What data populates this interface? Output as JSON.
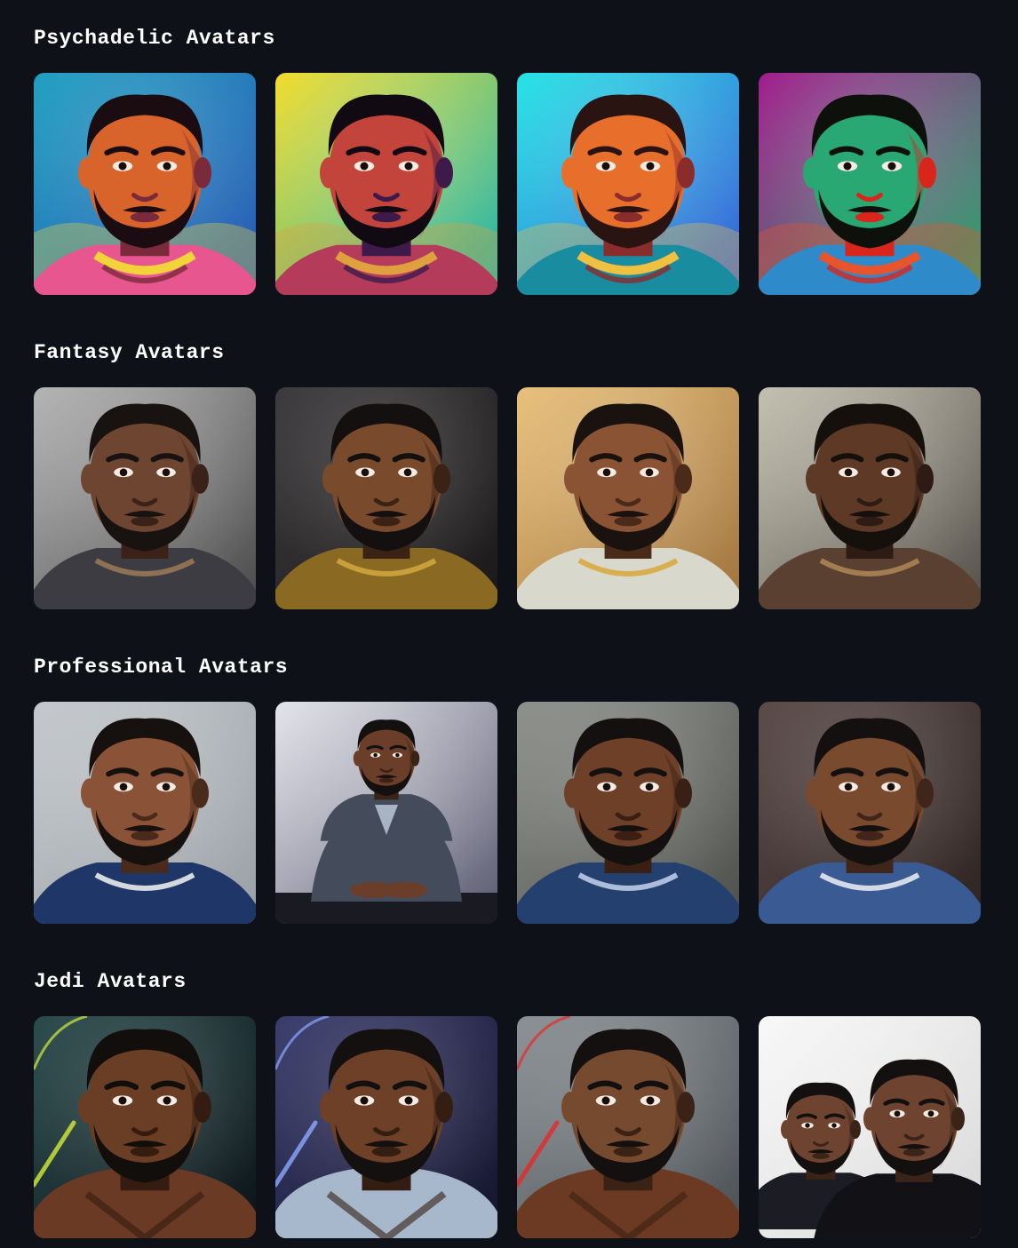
{
  "sections": [
    {
      "title": "Psychadelic Avatars",
      "avatars": [
        {
          "style": "psychedelic",
          "bg1": "#1f9fc0",
          "bg2": "#2a57b4",
          "skin": "#d8642c",
          "shade": "#7a2a3a",
          "hair": "#1a0c10",
          "beard": "#1a0c10",
          "outfit": "#e8568f",
          "accent": "#f2d43a"
        },
        {
          "style": "psychedelic",
          "bg1": "#f3dc2c",
          "bg2": "#18b4b4",
          "skin": "#c2443a",
          "shade": "#3d1a4a",
          "hair": "#120a12",
          "beard": "#120a12",
          "outfit": "#b43c5a",
          "accent": "#e0a040"
        },
        {
          "style": "psychedelic",
          "bg1": "#25e4e4",
          "bg2": "#3c5ad8",
          "skin": "#e86e2c",
          "shade": "#8a2c2c",
          "hair": "#2a1412",
          "beard": "#2a1412",
          "outfit": "#1a8ca0",
          "accent": "#f0c040"
        },
        {
          "style": "psychedelic",
          "bg1": "#a21c8c",
          "bg2": "#2ca86c",
          "skin": "#2aa874",
          "shade": "#d8261c",
          "hair": "#0e100c",
          "beard": "#0e100c",
          "outfit": "#2e8ac8",
          "accent": "#e8542c"
        }
      ]
    },
    {
      "title": "Fantasy Avatars",
      "avatars": [
        {
          "style": "realistic",
          "bg1": "#b4b4b4",
          "bg2": "#4a4a4a",
          "skin": "#6e4530",
          "shade": "#3a2218",
          "hair": "#181210",
          "beard": "#181210",
          "outfit": "#3c3c42",
          "accent": "#9c7a58"
        },
        {
          "style": "realistic",
          "bg1": "#3c3a3c",
          "bg2": "#1a1818",
          "skin": "#7a4a2c",
          "shade": "#3a2214",
          "hair": "#141010",
          "beard": "#141010",
          "outfit": "#8a6a22",
          "accent": "#d4a840"
        },
        {
          "style": "realistic",
          "bg1": "#e8c07a",
          "bg2": "#a0733e",
          "skin": "#8a5434",
          "shade": "#4a2a18",
          "hair": "#1a120e",
          "beard": "#1a120e",
          "outfit": "#d8d8cc",
          "accent": "#d8a838"
        },
        {
          "style": "realistic",
          "bg1": "#c4c0b0",
          "bg2": "#54504a",
          "skin": "#5e3a26",
          "shade": "#2e1c14",
          "hair": "#16100c",
          "beard": "#16100c",
          "outfit": "#5a4030",
          "accent": "#b08858"
        }
      ]
    },
    {
      "title": "Professional Avatars",
      "avatars": [
        {
          "style": "realistic",
          "bg1": "#c4c8cc",
          "bg2": "#9aa0a6",
          "skin": "#8a5236",
          "shade": "#4a2a1a",
          "hair": "#16100e",
          "beard": "#16100e",
          "outfit": "#1e3668",
          "accent": "#f4f4f4"
        },
        {
          "style": "seated",
          "bg1": "#e4e4ec",
          "bg2": "#5a5a70",
          "skin": "#6a3e28",
          "shade": "#3a2214",
          "hair": "#141010",
          "beard": "#141010",
          "outfit": "#444c5c",
          "accent": "#a8b4c4"
        },
        {
          "style": "realistic",
          "bg1": "#8e908c",
          "bg2": "#4e504c",
          "skin": "#6e4028",
          "shade": "#3a2014",
          "hair": "#141010",
          "beard": "#141010",
          "outfit": "#24406e",
          "accent": "#c4d4ec"
        },
        {
          "style": "realistic",
          "bg1": "#5a4a48",
          "bg2": "#2e2422",
          "skin": "#7a4a2e",
          "shade": "#40261a",
          "hair": "#141010",
          "beard": "#141010",
          "outfit": "#3a5a94",
          "accent": "#f0f0f4"
        }
      ]
    },
    {
      "title": "Jedi Avatars",
      "avatars": [
        {
          "style": "jedi",
          "bg1": "#2a4a4c",
          "bg2": "#0c1418",
          "skin": "#6a3e24",
          "shade": "#341c10",
          "hair": "#120e0c",
          "beard": "#120e0c",
          "outfit": "#6a3a24",
          "accent": "#d6ec3a"
        },
        {
          "style": "jedi",
          "bg1": "#3a3c6c",
          "bg2": "#14142c",
          "skin": "#6e4028",
          "shade": "#341e12",
          "hair": "#141010",
          "beard": "#141010",
          "outfit": "#a8b8cc",
          "accent": "#8aa8ff"
        },
        {
          "style": "jedi",
          "bg1": "#8a9094",
          "bg2": "#4c5054",
          "skin": "#764a2e",
          "shade": "#3a2214",
          "hair": "#141010",
          "beard": "#141010",
          "outfit": "#6c3a22",
          "accent": "#e82828"
        },
        {
          "style": "duo",
          "bg1": "#f8f8f8",
          "bg2": "#d8d8d8",
          "skin": "#6e4430",
          "shade": "#3a2418",
          "hair": "#141010",
          "beard": "#141010",
          "outfit": "#1c1c24",
          "accent": "#cccccc"
        }
      ]
    }
  ]
}
